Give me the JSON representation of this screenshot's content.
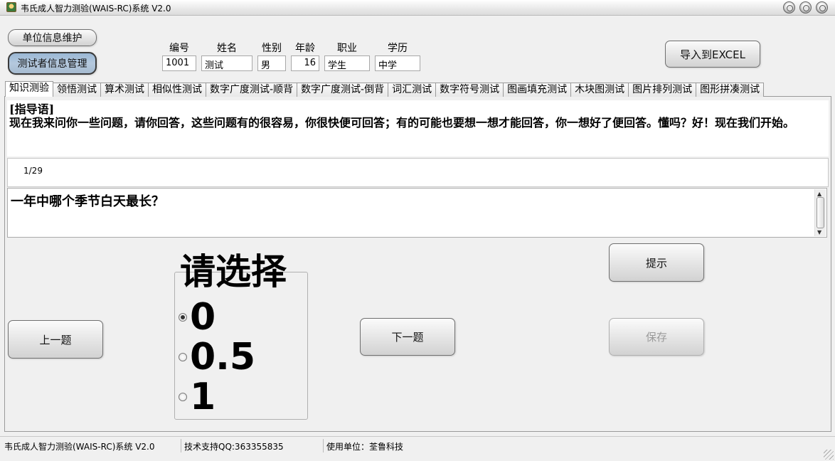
{
  "window": {
    "title": "韦氏成人智力测验(WAIS-RC)系统 V2.0"
  },
  "toolbar": {
    "unit_info_label": "单位信息维护",
    "tester_info_label": "测试者信息管理",
    "export_label": "导入到EXCEL"
  },
  "subject": {
    "id_label": "编号",
    "id_value": "1001",
    "name_label": "姓名",
    "name_value": "测试",
    "gender_label": "性别",
    "gender_value": "男",
    "age_label": "年龄",
    "age_value": "16",
    "job_label": "职业",
    "job_value": "学生",
    "edu_label": "学历",
    "edu_value": "中学"
  },
  "tabs": [
    {
      "label": "知识测验",
      "active": true
    },
    {
      "label": "领悟测试"
    },
    {
      "label": "算术测试"
    },
    {
      "label": "相似性测试"
    },
    {
      "label": "数字广度测试-顺背"
    },
    {
      "label": "数字广度测试-倒背"
    },
    {
      "label": "词汇测试"
    },
    {
      "label": "数字符号测试"
    },
    {
      "label": "图画填充测试"
    },
    {
      "label": "木块图测试"
    },
    {
      "label": "图片排列测试"
    },
    {
      "label": "图形拼凑测试"
    }
  ],
  "instructions": {
    "title": "[指导语]",
    "text": "现在我来问你一些问题，请你回答，这些问题有的很容易，你很快便可回答；有的可能也要想一想才能回答，你一想好了便回答。懂吗？好！现在我们开始。"
  },
  "progress": "1/29",
  "question": "一年中哪个季节白天最长？",
  "choice": {
    "heading": "请选择",
    "options": [
      {
        "label": "0",
        "checked": true
      },
      {
        "label": "0.5",
        "checked": false
      },
      {
        "label": "1",
        "checked": false
      }
    ]
  },
  "nav": {
    "prev_label": "上一题",
    "next_label": "下一题",
    "hint_label": "提示",
    "save_label": "保存"
  },
  "status": {
    "app": "韦氏成人智力测验(WAIS-RC)系统 V2.0",
    "support": "技术支持QQ:363355835",
    "user": "使用单位：荃鲁科技"
  }
}
